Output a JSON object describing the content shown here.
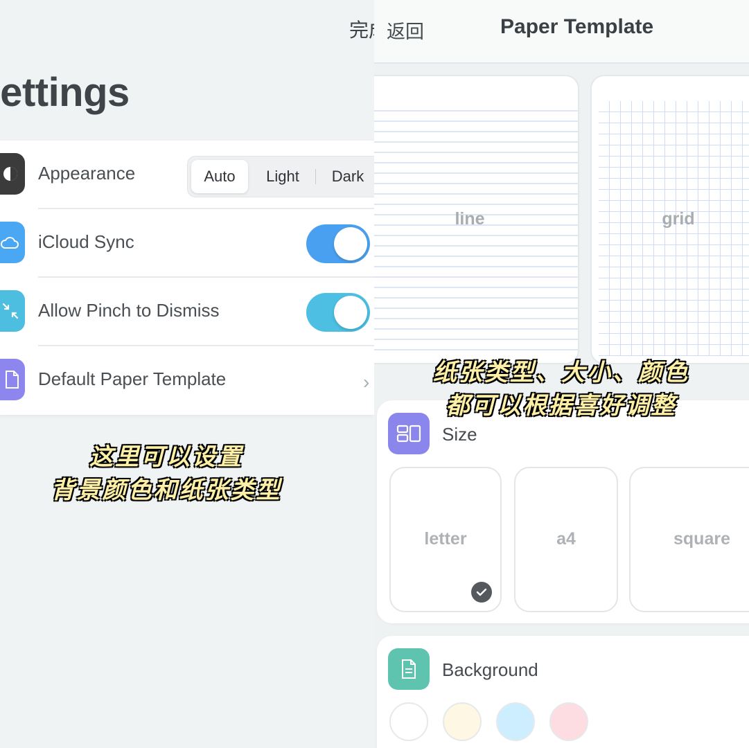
{
  "left": {
    "done_label": "完成",
    "title": "Settings",
    "appearance": {
      "label": "Appearance",
      "options": [
        "Auto",
        "Light",
        "Dark"
      ],
      "selected": "Auto",
      "icon": "contrast-icon",
      "icon_color": "#3b3b3b"
    },
    "icloud": {
      "label": "iCloud Sync",
      "enabled": true,
      "icon": "cloud-icon",
      "icon_color": "#4aa7f4",
      "toggle_color": "#4aa0f0"
    },
    "pinch": {
      "label": "Allow Pinch to Dismiss",
      "enabled": true,
      "icon": "pinch-arrows-icon",
      "icon_color": "#4dbde0",
      "toggle_color": "#4cbfe3"
    },
    "paper_template": {
      "label": "Default Paper Template",
      "icon": "document-icon",
      "icon_color": "#8d86ee"
    },
    "caption": [
      "这里可以设置",
      "背景颜色和纸张类型"
    ]
  },
  "right": {
    "back_label": "返回",
    "title": "Paper Template",
    "types": [
      {
        "label": "line"
      },
      {
        "label": "grid"
      }
    ],
    "caption": [
      "纸张类型、大小、颜色",
      "都可以根据喜好调整"
    ],
    "size": {
      "title": "Size",
      "icon": "layout-icon",
      "icon_color": "#8a86ec",
      "options": [
        "letter",
        "a4",
        "square"
      ],
      "selected": "letter"
    },
    "background": {
      "title": "Background",
      "icon": "document-lines-icon",
      "icon_color": "#5ec4b0",
      "swatches": [
        "#ffffff",
        "#fdf7e4",
        "#cdeefe",
        "#fddde2"
      ]
    }
  }
}
